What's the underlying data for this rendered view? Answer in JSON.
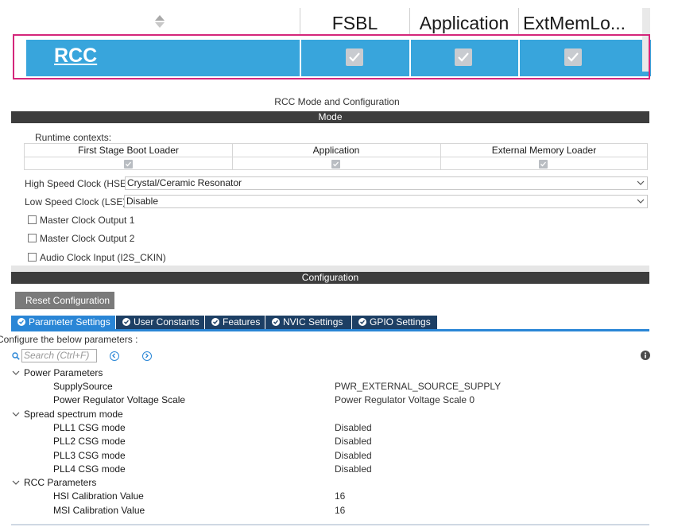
{
  "top_table": {
    "columns": [
      "FSBL",
      "Application",
      "ExtMemLo..."
    ],
    "row_label": "RCC",
    "row_checks": [
      true,
      true,
      true
    ]
  },
  "mode_panel": {
    "title": "RCC Mode and Configuration",
    "mode_header": "Mode",
    "runtime_contexts_label": "Runtime contexts:",
    "contexts": [
      {
        "label": "First Stage Boot Loader",
        "checked": true
      },
      {
        "label": "Application",
        "checked": true
      },
      {
        "label": "External Memory Loader",
        "checked": true
      }
    ],
    "hse": {
      "label": "High Speed Clock (HSE)",
      "value": "Crystal/Ceramic Resonator"
    },
    "lse": {
      "label": "Low Speed Clock (LSE)",
      "value": "Disable"
    },
    "checkboxes": [
      {
        "label": "Master Clock Output 1",
        "checked": false
      },
      {
        "label": "Master Clock Output 2",
        "checked": false
      },
      {
        "label": "Audio Clock Input (I2S_CKIN)",
        "checked": false
      }
    ]
  },
  "configuration": {
    "header": "Configuration",
    "reset_label": "Reset Configuration",
    "tabs": [
      {
        "label": "Parameter Settings",
        "active": true
      },
      {
        "label": "User Constants",
        "active": false
      },
      {
        "label": "Features",
        "active": false
      },
      {
        "label": "NVIC Settings",
        "active": false
      },
      {
        "label": "GPIO Settings",
        "active": false
      }
    ],
    "instruction": "Configure the below parameters :",
    "search_placeholder": "Search (Ctrl+F)",
    "groups": [
      {
        "name": "Power Parameters",
        "params": [
          {
            "name": "SupplySource",
            "value": "PWR_EXTERNAL_SOURCE_SUPPLY"
          },
          {
            "name": "Power Regulator Voltage Scale",
            "value": "Power Regulator Voltage Scale 0"
          }
        ]
      },
      {
        "name": "Spread spectrum mode",
        "params": [
          {
            "name": "PLL1 CSG mode",
            "value": "Disabled"
          },
          {
            "name": "PLL2 CSG mode",
            "value": "Disabled"
          },
          {
            "name": "PLL3 CSG mode",
            "value": "Disabled"
          },
          {
            "name": "PLL4 CSG mode",
            "value": "Disabled"
          }
        ]
      },
      {
        "name": "RCC Parameters",
        "params": [
          {
            "name": "HSI Calibration Value",
            "value": "16"
          },
          {
            "name": "MSI Calibration Value",
            "value": "16"
          }
        ]
      }
    ]
  },
  "colors": {
    "selected_row": "#38a5dc",
    "highlight_frame": "#d4267b",
    "dark_header": "#3d3d3d",
    "tab_active": "#2a86d6",
    "tab_inactive": "#1d3f64"
  }
}
